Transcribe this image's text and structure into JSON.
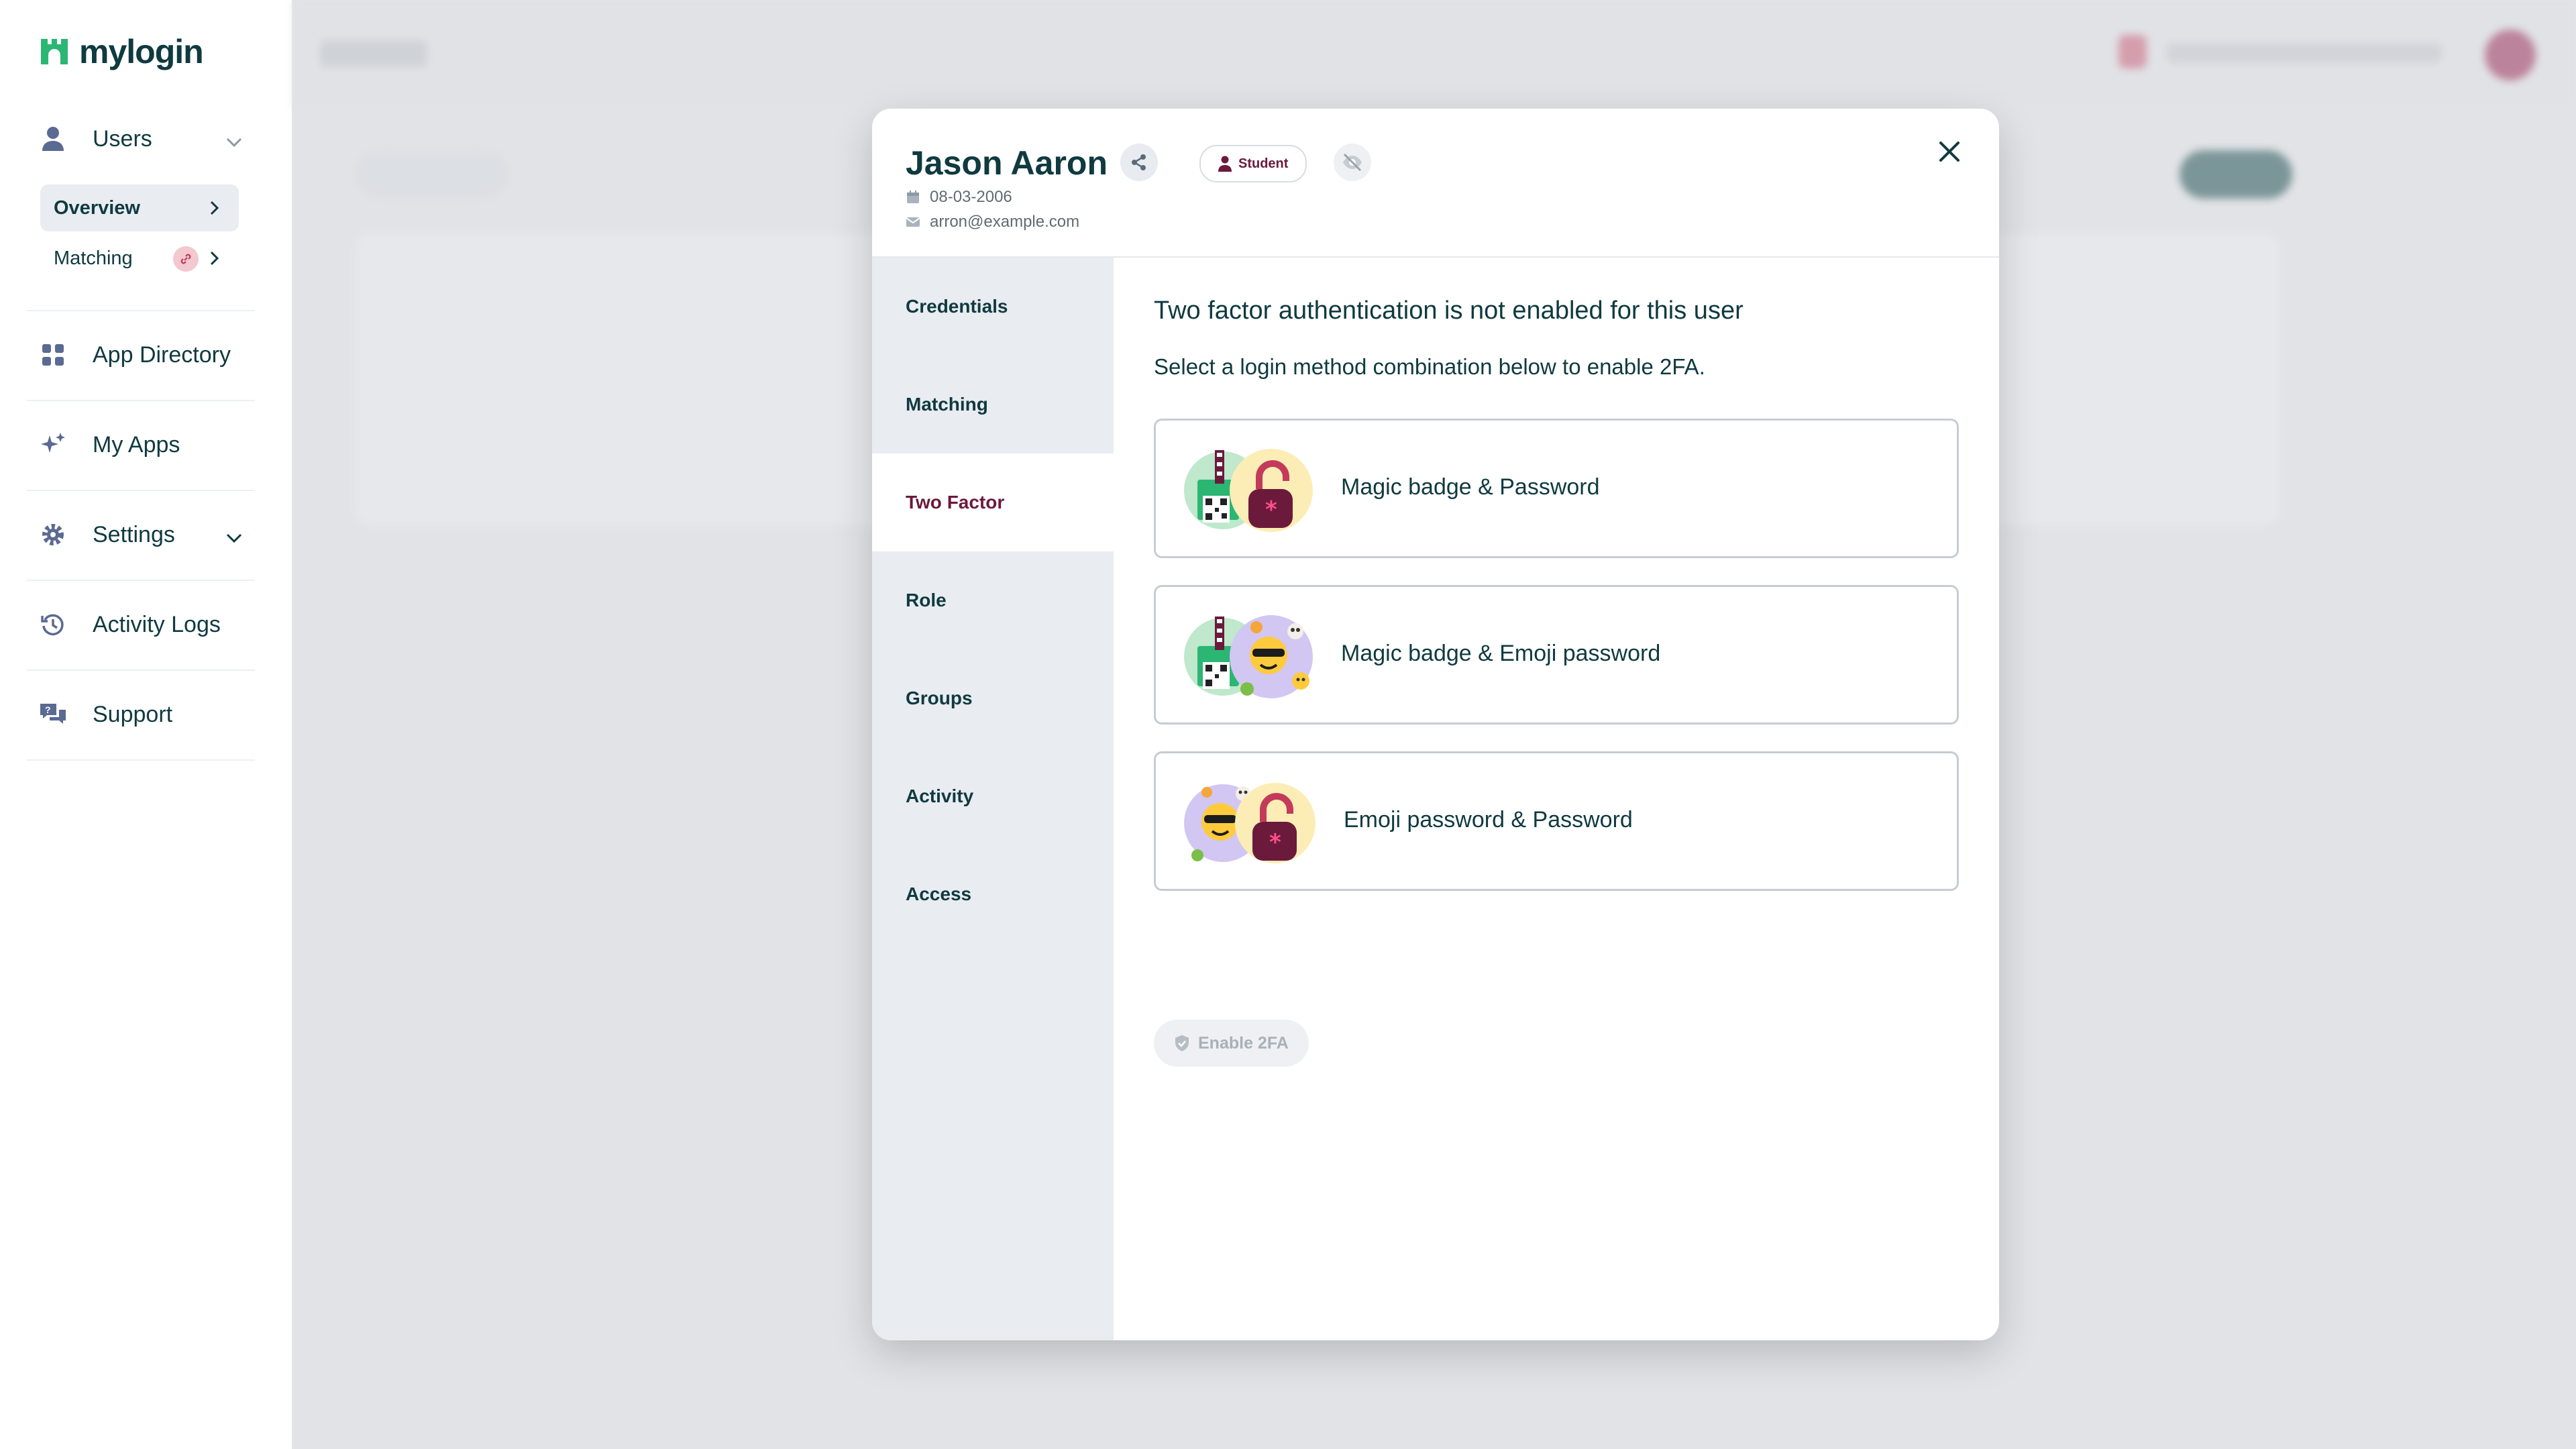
{
  "app": {
    "logo_text": "mylogin"
  },
  "sidebar": {
    "users_label": "Users",
    "overview_label": "Overview",
    "matching_label": "Matching",
    "app_directory_label": "App Directory",
    "my_apps_label": "My Apps",
    "settings_label": "Settings",
    "activity_logs_label": "Activity Logs",
    "support_label": "Support"
  },
  "modal": {
    "user_name": "Jason Aaron",
    "role_badge": "Student",
    "birth_date": "08-03-2006",
    "email": "arron@example.com",
    "tabs": [
      {
        "label": "Credentials"
      },
      {
        "label": "Matching"
      },
      {
        "label": "Two Factor"
      },
      {
        "label": "Role"
      },
      {
        "label": "Groups"
      },
      {
        "label": "Activity"
      },
      {
        "label": "Access"
      }
    ],
    "active_tab": "Two Factor",
    "content": {
      "title": "Two factor authentication is not enabled for this user",
      "subtitle": "Select a login method combination below to enable 2FA.",
      "options": [
        {
          "label": "Magic badge & Password",
          "icons": [
            "magic-badge-icon",
            "password-lock-icon"
          ]
        },
        {
          "label": "Magic badge & Emoji password",
          "icons": [
            "magic-badge-icon",
            "emoji-password-icon"
          ]
        },
        {
          "label": "Emoji password & Password",
          "icons": [
            "emoji-password-icon",
            "password-lock-icon"
          ]
        }
      ],
      "enable_button": "Enable 2FA"
    }
  },
  "colors": {
    "brand_teal": "#0f3a40",
    "brand_green": "#2bb673",
    "accent_plum": "#6b1a3c",
    "disabled_text": "#a8b0b8"
  }
}
